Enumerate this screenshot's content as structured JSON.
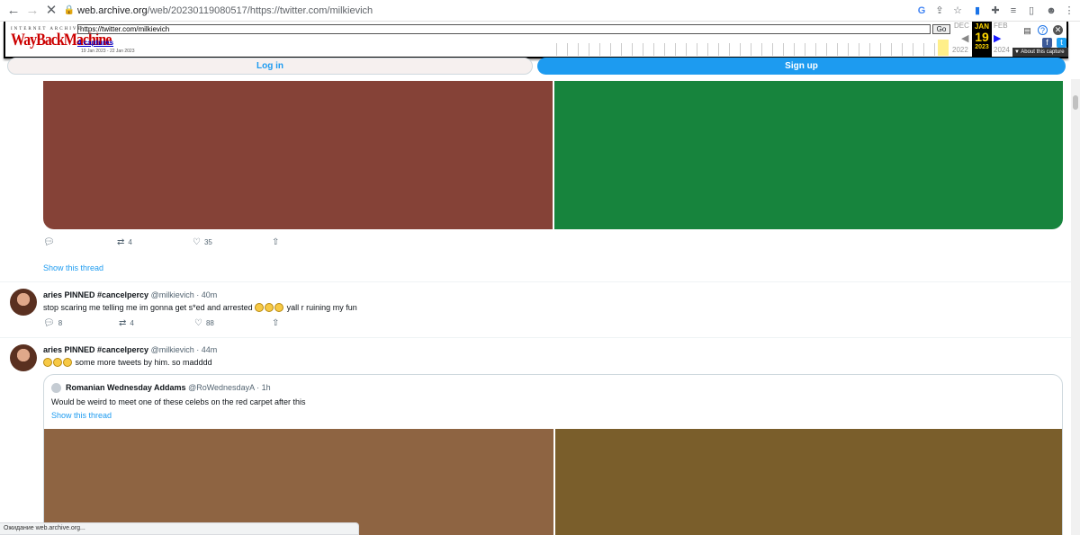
{
  "browser": {
    "url_host": "web.archive.org",
    "url_path": "/web/20230119080517/https://twitter.com/milkievich"
  },
  "wayback": {
    "logo_top": "INTERNET ARCHIVE",
    "logo": "WayBackMachine",
    "url_value": "https://twitter.com/milkievich",
    "go_label": "Go",
    "captures": "4 captures",
    "range": "19 Jan 2023 - 22 Jan 2023",
    "prev_month": "DEC",
    "cur_month": "JAN",
    "next_month": "FEB",
    "cur_day": "19",
    "prev_year": "2022",
    "cur_year": "2023",
    "next_year": "2024",
    "about": "▼ About this capture"
  },
  "auth": {
    "login": "Log in",
    "signup": "Sign up"
  },
  "tweet0": {
    "media_colors": [
      "#854237",
      "#17843d"
    ],
    "retweets": "4",
    "likes": "35",
    "thread_link": "Show this thread"
  },
  "tweet1": {
    "name": "aries PINNED #cancelpercy",
    "handle_time": "@milkievich · 40m",
    "text_before": "stop scaring me telling me im gonna get s*ed and arrested",
    "text_after": "yall r ruining my fun",
    "replies": "8",
    "retweets": "4",
    "likes": "88"
  },
  "tweet2": {
    "name": "aries PINNED #cancelpercy",
    "handle_time": "@milkievich · 44m",
    "text": "some more tweets by him. so madddd",
    "quote": {
      "name": "Romanian Wednesday Addams",
      "handle_time": "@RoWednesdayA · 1h",
      "text": "Would be weird to meet one of these celebs on the red carpet after this",
      "thread_link": "Show this thread",
      "media_colors": [
        "#8e6442",
        "#7a5e2b"
      ]
    }
  },
  "status_text": "Ожидание web.archive.org..."
}
